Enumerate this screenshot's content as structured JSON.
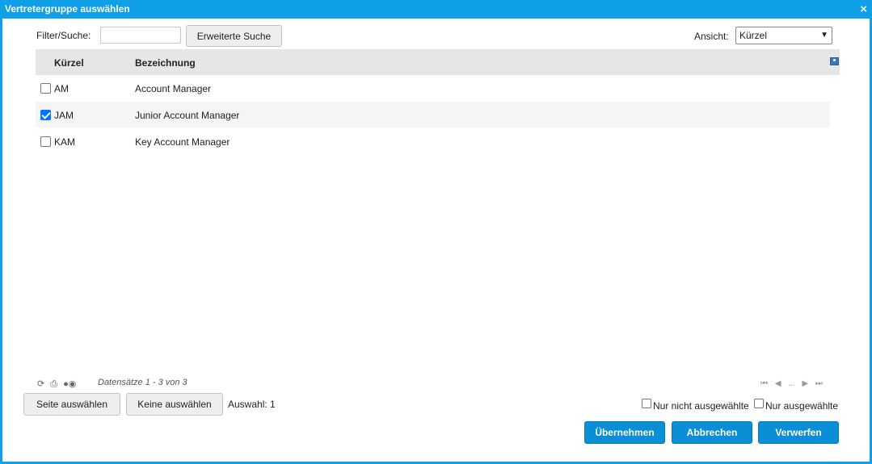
{
  "dialog": {
    "title": "Vertretergruppe auswählen",
    "close_label": "×"
  },
  "toolbar": {
    "filter_label": "Filter/Suche:",
    "filter_value": "",
    "advanced_search_label": "Erweiterte Suche",
    "view_label": "Ansicht:",
    "view_selected": "Kürzel"
  },
  "grid": {
    "headers": {
      "kurzel": "Kürzel",
      "bezeichnung": "Bezeichnung"
    },
    "rows": [
      {
        "kurzel": "AM",
        "bezeichnung": "Account Manager",
        "checked": false
      },
      {
        "kurzel": "JAM",
        "bezeichnung": "Junior Account Manager",
        "checked": true
      },
      {
        "kurzel": "KAM",
        "bezeichnung": "Key Account Manager",
        "checked": false
      }
    ]
  },
  "footer": {
    "records_info": "Datensätze 1 - 3 von 3",
    "pager_ellipsis": "...",
    "select_page_label": "Seite auswählen",
    "select_none_label": "Keine auswählen",
    "selection_count": "Auswahl: 1",
    "only_unselected_label": "Nur nicht ausgewählte",
    "only_selected_label": "Nur ausgewählte"
  },
  "actions": {
    "apply_label": "Übernehmen",
    "cancel_label": "Abbrechen",
    "discard_label": "Verwerfen"
  },
  "colors": {
    "accent": "#0fa0e8",
    "primary_button": "#0a8fd6",
    "checkbox_checked": "#0075ff"
  },
  "icons": [
    "close-icon",
    "refresh-icon",
    "print-icon",
    "settings-icon",
    "column-config-icon",
    "first-page-icon",
    "prev-page-icon",
    "next-page-icon",
    "last-page-icon",
    "chevron-down-icon"
  ]
}
